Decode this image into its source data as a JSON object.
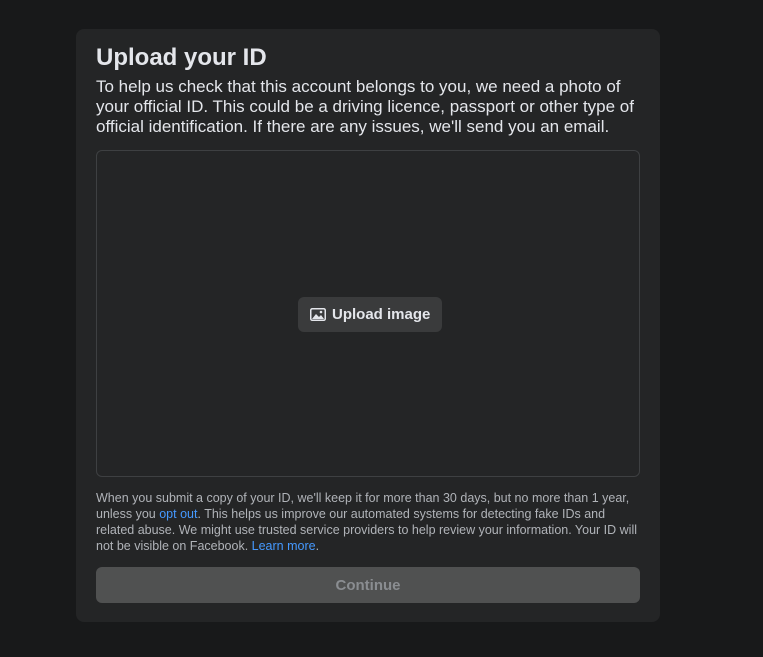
{
  "dialog": {
    "title": "Upload your ID",
    "intro": "To help us check that this account belongs to you, we need a photo of your official ID. This could be a driving licence, passport or other type of official identification. If there are any issues, we'll send you an email."
  },
  "upload": {
    "button_label": "Upload image",
    "icon": "image-icon"
  },
  "disclaimer": {
    "part1": "When you submit a copy of your ID, we'll keep it for more than 30 days, but no more than 1 year, unless you ",
    "opt_out_link": "opt out",
    "part2": ". This helps us improve our automated systems for detecting fake IDs and related abuse. We might use trusted service providers to help review your information. Your ID will not be visible on Facebook. ",
    "learn_more_link": "Learn more",
    "part3": "."
  },
  "footer": {
    "continue_label": "Continue"
  },
  "colors": {
    "page_bg": "#18191a",
    "card_bg": "#242526",
    "link": "#4599ff",
    "primary_text": "#e4e6eb",
    "secondary_text": "#b0b3b8",
    "disabled_button": "#505151"
  }
}
